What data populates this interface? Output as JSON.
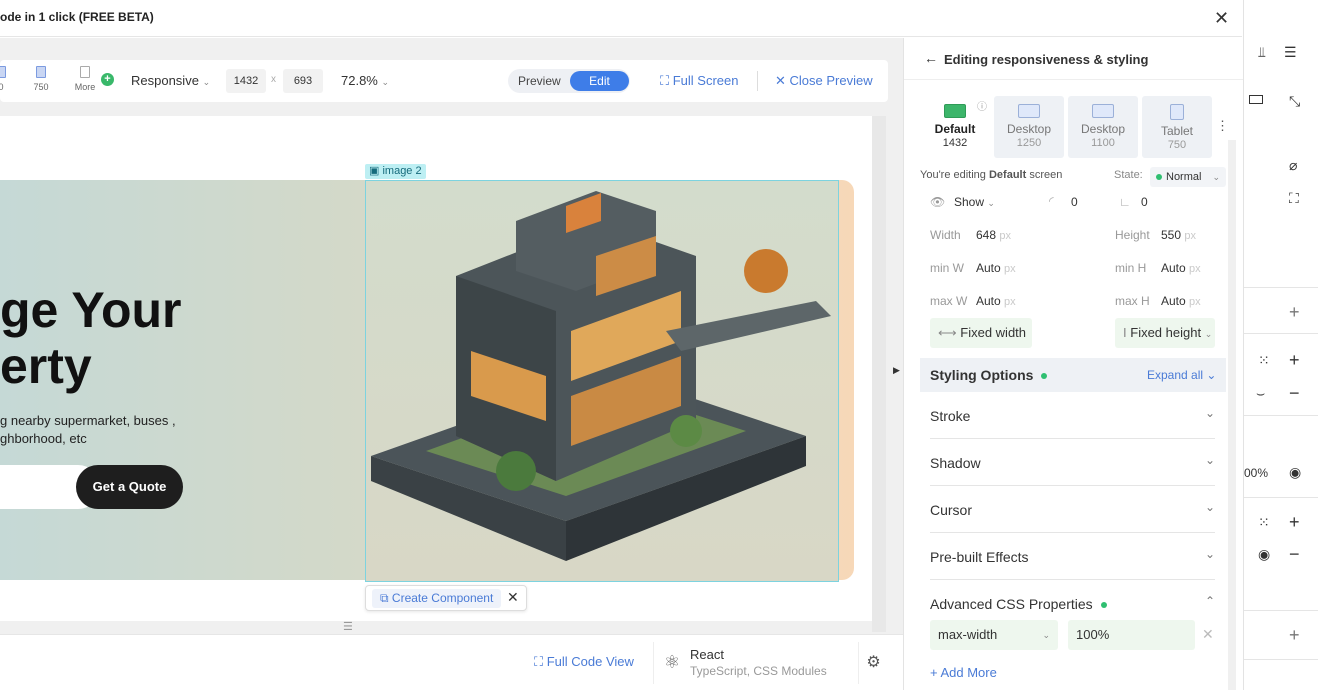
{
  "window": {
    "title": "ode in 1 click (FREE BETA)"
  },
  "toolbar": {
    "devices": [
      {
        "label": "0"
      },
      {
        "label": "750"
      },
      {
        "label": "More"
      }
    ],
    "responsive": "Responsive",
    "width_value": "1432",
    "times": "x",
    "height_value": "693",
    "zoom": "72.8%",
    "preview": "Preview",
    "edit": "Edit",
    "full_screen": "Full Screen",
    "close_preview": "Close Preview"
  },
  "canvas": {
    "image_label": "image 2",
    "headline_line1": "ge Your",
    "headline_line2": "erty",
    "subtext_line1": "g nearby supermarket, buses ,",
    "subtext_line2": "ghborhood, etc",
    "cta": "Get a Quote",
    "create_component": "Create Component"
  },
  "bottom": {
    "full_code_view": "Full Code View",
    "framework": "React",
    "framework_sub": "TypeScript, CSS Modules"
  },
  "panel": {
    "title": "Editing responsiveness & styling",
    "device_tabs": [
      {
        "name": "Default",
        "width": "1432"
      },
      {
        "name": "Desktop",
        "width": "1250"
      },
      {
        "name": "Desktop",
        "width": "1100"
      },
      {
        "name": "Tablet",
        "width": "750"
      }
    ],
    "editing_prefix": "You're editing ",
    "editing_screen": "Default",
    "editing_suffix": " screen",
    "state_label": "State:",
    "state_value": "Normal",
    "show": "Show",
    "radius_value": "0",
    "corner_value": "0",
    "width_label": "Width",
    "width_value": "648",
    "height_label": "Height",
    "height_value": "550",
    "minw_label": "min W",
    "minw_value": "Auto",
    "minh_label": "min H",
    "minh_value": "Auto",
    "maxw_label": "max W",
    "maxw_value": "Auto",
    "maxh_label": "max H",
    "maxh_value": "Auto",
    "unit": "px",
    "fixed_width": "Fixed width",
    "fixed_height": "Fixed height",
    "styling_options": "Styling Options",
    "expand_all": "Expand all",
    "sections": [
      "Stroke",
      "Shadow",
      "Cursor",
      "Pre-built Effects",
      "Advanced CSS Properties"
    ],
    "css_property": "max-width",
    "css_value": "100%",
    "add_more": "+ Add More"
  },
  "right_strip": {
    "opacity": "00%"
  }
}
